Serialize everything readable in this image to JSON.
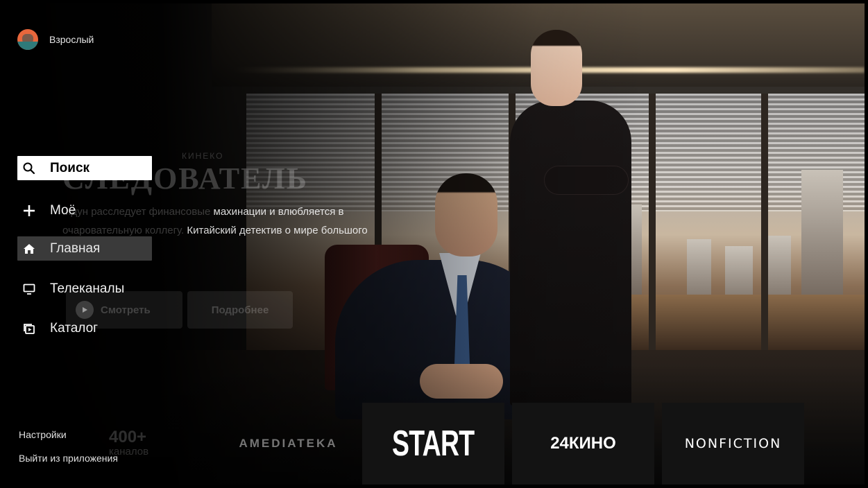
{
  "profile": {
    "name": "Взрослый",
    "avatar_icon": "user-avatar-icon"
  },
  "nav": [
    {
      "label": "Поиск",
      "icon": "search-icon",
      "state": "focused"
    },
    {
      "label": "Моё",
      "icon": "plus-icon",
      "state": "default"
    },
    {
      "label": "Главная",
      "icon": "home-icon",
      "state": "active"
    },
    {
      "label": "Телеканалы",
      "icon": "tv-icon",
      "state": "default"
    },
    {
      "label": "Каталог",
      "icon": "catalog-icon",
      "state": "default"
    }
  ],
  "footer": {
    "settings": "Настройки",
    "exit": "Выйти из приложения"
  },
  "hero": {
    "brand": "КИНЕКО",
    "title": "СЛЕДОВАТЕЛЬ",
    "description_dim_1": "...дун расследует финансовые",
    "description_1": " махинации и влюбляется в",
    "description_dim_2": "очаровательную коллегу.",
    "description_2": " Китайский детектив о мире большого",
    "watch_label": "Смотреть",
    "more_label": "Подробнее"
  },
  "channels": {
    "count": "400+",
    "label": "каналов"
  },
  "providers": [
    "AMEDIATEKA",
    "START",
    "24КИНО",
    "NONFICTION"
  ],
  "colors": {
    "focus_bg": "#ffffff",
    "active_bg": "#3a3a3a",
    "avatar": "#e8673c",
    "background": "#000000"
  }
}
